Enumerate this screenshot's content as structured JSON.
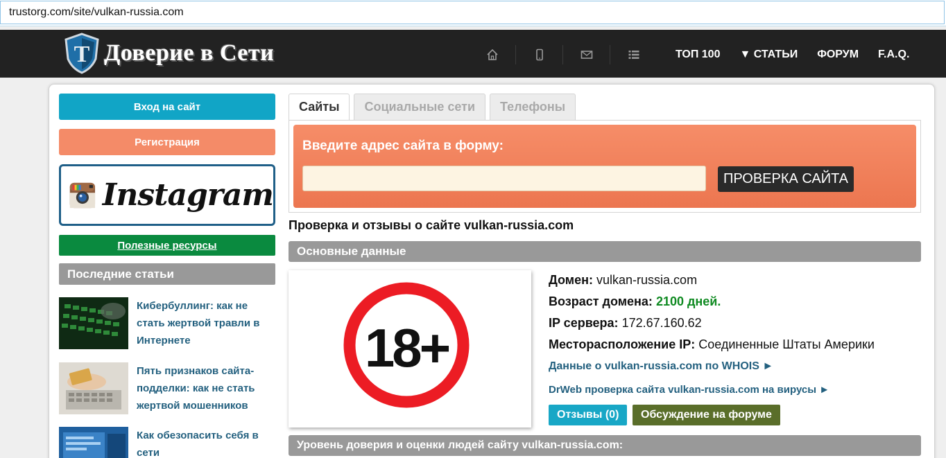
{
  "browser": {
    "url": "trustorg.com/site/vulkan-russia.com"
  },
  "header": {
    "logo_text": "Доверие в Сети",
    "icons": [
      "home-icon",
      "mobile-icon",
      "mail-icon",
      "list-icon"
    ],
    "nav": [
      "ТОП 100",
      "▼ СТАТЬИ",
      "ФОРУМ",
      "F.A.Q."
    ]
  },
  "sidebar": {
    "login": "Вход на сайт",
    "register": "Регистрация",
    "instagram_text": "Instagram",
    "resources": "Полезные ресурсы",
    "latest_heading": "Последние статьи",
    "articles": [
      "Кибербуллинг: как не стать жертвой травли в Интернете",
      "Пять признаков сайта-подделки: как не стать жертвой мошенников",
      "Как обезопасить себя в сети"
    ]
  },
  "main": {
    "tabs": [
      "Сайты",
      "Социальные сети",
      "Телефоны"
    ],
    "form_label": "Введите адрес сайта в форму:",
    "check_button": "ПРОВЕРКА САЙТА",
    "page_title": "Проверка и отзывы о сайте vulkan-russia.com",
    "basic_heading": "Основные данные",
    "age_badge": "18+",
    "domain_label": "Домен:",
    "domain_value": "vulkan-russia.com",
    "age_label": "Возраст домена:",
    "age_value": "2100 дней.",
    "ip_label": "IP сервера:",
    "ip_value": "172.67.160.62",
    "loc_label": "Месторасположение IP:",
    "loc_value": "Соединенные Штаты Америки",
    "whois_link": "Данные о vulkan-russia.com по WHOIS ►",
    "drweb_link": "DrWeb проверка сайта vulkan-russia.com на вирусы ►",
    "reviews_button": "Отзывы (0)",
    "forum_button": "Обсуждение на форуме",
    "trust_heading": "Уровень доверия и оценки людей сайту vulkan-russia.com:"
  },
  "colors": {
    "login": "#11a5c6",
    "register": "#f48b68",
    "resources": "#0a8a3f",
    "forum_button": "#5a6e2a",
    "age_value": "#0f8a21",
    "link": "#23607f"
  }
}
